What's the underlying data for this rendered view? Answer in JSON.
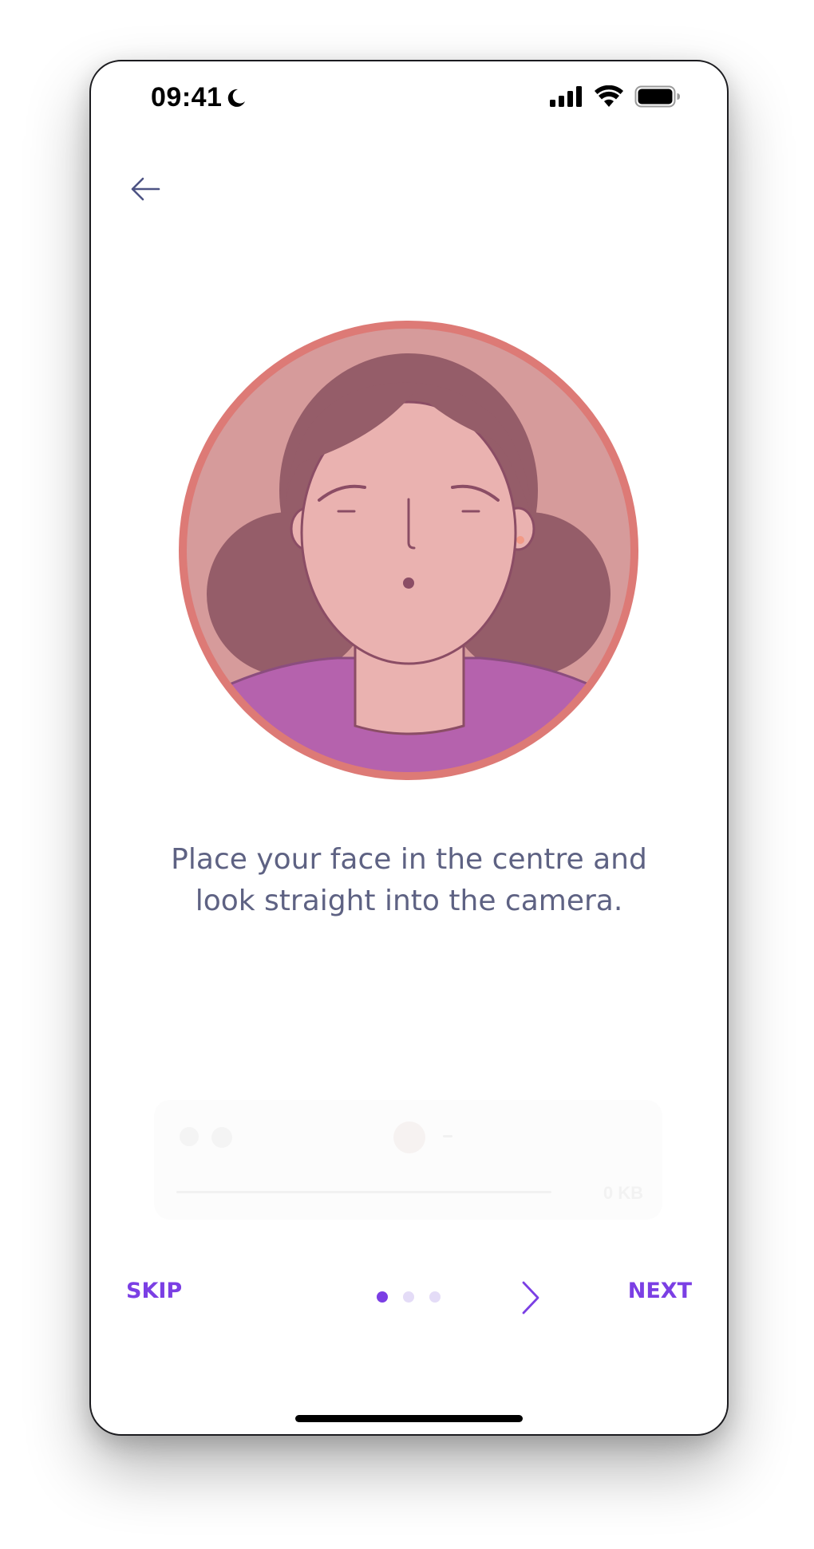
{
  "status_bar": {
    "time": "09:41",
    "moon_icon": "moon-icon",
    "signal_icon": "cellular-signal-icon",
    "wifi_icon": "wifi-icon",
    "battery_icon": "battery-icon"
  },
  "header": {
    "back_icon": "arrow-left-icon"
  },
  "illustration": {
    "name": "face-avatar-illustration",
    "ring_color": "#dd7a76",
    "background_color": "#d69b9b",
    "hair_color": "#955d69",
    "skin_color": "#eab2b0",
    "shirt_color": "#b562ad"
  },
  "instruction": {
    "text": "Place your face in the centre and\nlook straight into the camera."
  },
  "ghost_player": {
    "size_label": "0 KB"
  },
  "bottom_nav": {
    "skip_label": "SKIP",
    "next_label": "NEXT",
    "pagination": {
      "total": 3,
      "active": 1
    },
    "chevron_icon": "chevron-right-icon",
    "accent_color": "#7b3fe4"
  }
}
